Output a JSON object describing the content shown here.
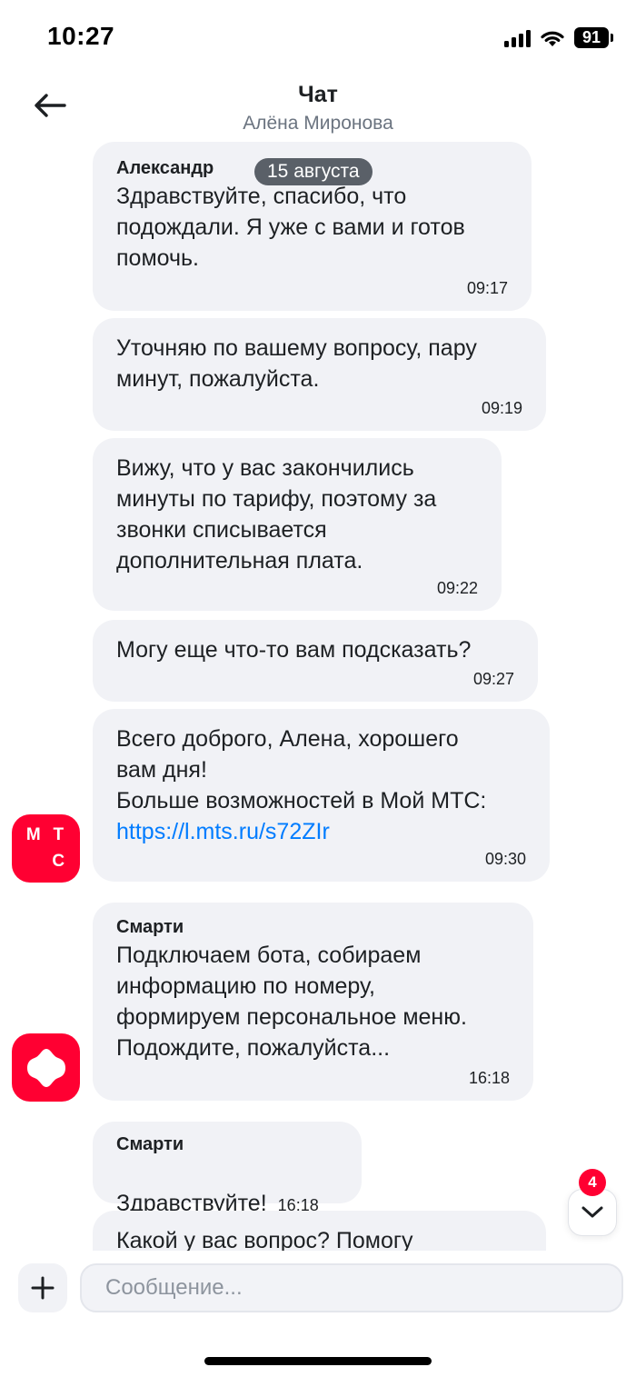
{
  "status_bar": {
    "time": "10:27",
    "battery": "91"
  },
  "header": {
    "title": "Чат",
    "subtitle": "Алёна Миронова"
  },
  "date_label": "15 августа",
  "messages": [
    {
      "sender": "Александр",
      "text": "Здравствуйте, спасибо, что\nподождали. Я уже с вами и готов\nпомочь.",
      "time": "09:17"
    },
    {
      "text": "Уточняю по вашему вопросу, пару\nминут, пожалуйста.",
      "time": "09:19"
    },
    {
      "text": "Вижу, что у вас закончились\nминуты по тарифу, поэтому за\nзвонки списывается\nдополнительная плата.",
      "time": "09:22"
    },
    {
      "text": "Могу еще что-то вам подсказать?",
      "time": "09:27"
    },
    {
      "text": "Всего  доброго, Алена, хорошего\nвам дня!\nБольше возможностей в Мой МТС:",
      "link": "https://l.mts.ru/s72ZIr",
      "time": "09:30"
    },
    {
      "sender": "Смарти",
      "text": "Подключаем бота, собираем\nинформацию по номеру,\nформируем персональное меню.\nПодождите, пожалуйста...",
      "time": "16:18"
    },
    {
      "sender": "Смарти",
      "text": "Здравствуйте!",
      "time": "16:18"
    },
    {
      "text": "Какой у вас вопрос? Помогу"
    }
  ],
  "avatars": {
    "mts": {
      "letters": [
        "М",
        "Т",
        "",
        "С"
      ],
      "color": "#ff0032"
    },
    "smarty": {
      "icon": "smarty-star-icon",
      "color": "#ff0032"
    }
  },
  "scroll_button": {
    "unread_count": "4",
    "icon": "chevron-down-icon"
  },
  "input": {
    "placeholder": "Сообщение..."
  },
  "colors": {
    "bubble": "#f1f2f6",
    "accent": "#ff0032",
    "link": "#007cff",
    "date_pill": "#5a6068"
  }
}
